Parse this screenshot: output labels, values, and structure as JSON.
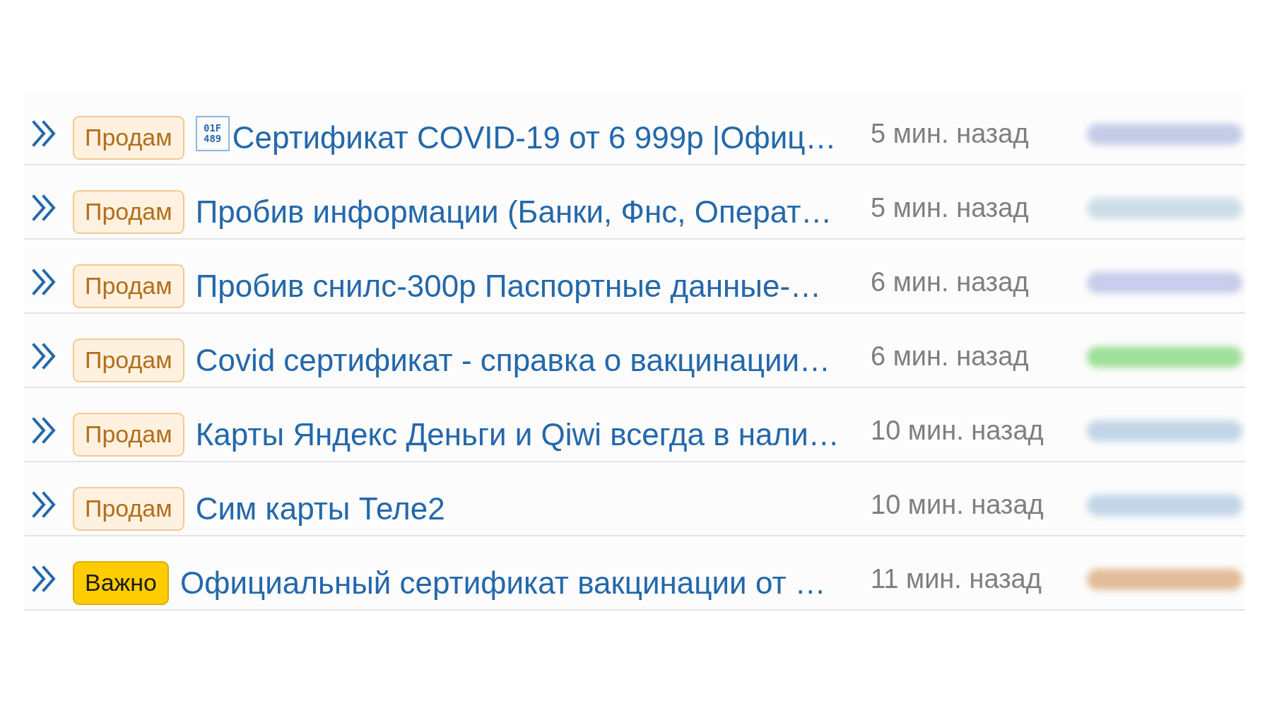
{
  "threads": [
    {
      "prefix": {
        "label": "Продам",
        "kind": "sell"
      },
      "missing_glyph": [
        "01F",
        "489"
      ],
      "title": "Сертификат COVID-19 от 6 999р |Офиц…",
      "time": "5 мин. назад",
      "author": {
        "color": "#c5cce8"
      }
    },
    {
      "prefix": {
        "label": "Продам",
        "kind": "sell"
      },
      "title": "Пробив информации (Банки, Фнс, Операт…",
      "time": "5 мин. назад",
      "author": {
        "color": "#cddde8"
      }
    },
    {
      "prefix": {
        "label": "Продам",
        "kind": "sell"
      },
      "title": "Пробив снилс-300р Паспортные данные-…",
      "time": "6 мин. назад",
      "author": {
        "color": "#c7cdeb"
      }
    },
    {
      "prefix": {
        "label": "Продам",
        "kind": "sell"
      },
      "title": "Covid сертификат - справка о вакцинации…",
      "time": "6 мин. назад",
      "author": {
        "color": "#9fe09a"
      }
    },
    {
      "prefix": {
        "label": "Продам",
        "kind": "sell"
      },
      "title": "Карты Яндекс Деньги и Qiwi всегда в нали…",
      "time": "10 мин. назад",
      "author": {
        "color": "#c2d6e8"
      }
    },
    {
      "prefix": {
        "label": "Продам",
        "kind": "sell"
      },
      "title": "Сим карты Теле2",
      "time": "10 мин. назад",
      "author": {
        "color": "#c2d6e8"
      }
    },
    {
      "prefix": {
        "label": "Важно",
        "kind": "important"
      },
      "title": "Официальный сертификат вакцинации от …",
      "time": "11 мин. назад",
      "author": {
        "color": "#e3bc98"
      }
    }
  ]
}
